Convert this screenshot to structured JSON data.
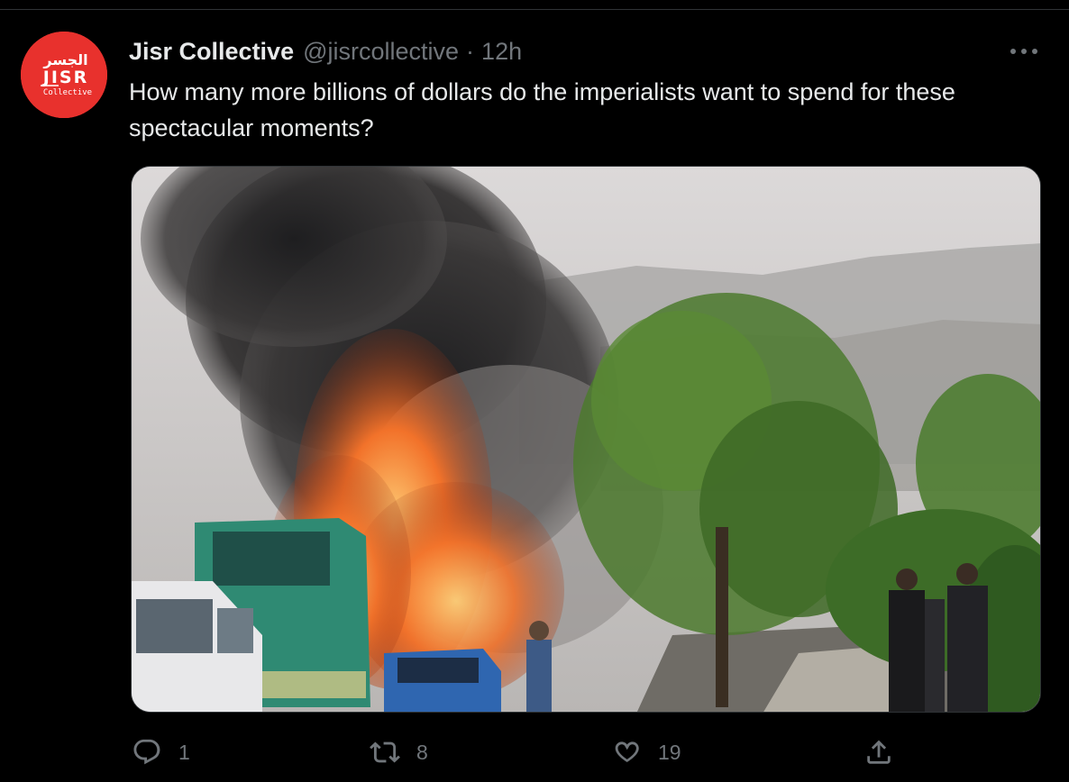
{
  "tweet": {
    "display_name": "Jisr Collective",
    "handle": "@jisrcollective",
    "separator": "·",
    "time": "12h",
    "text": "How many more billions of dollars do the imperialists want to spend for these spectacular moments?"
  },
  "avatar": {
    "arabic": "الجسر",
    "letters": "JISR",
    "subtitle": "Collective",
    "bg_color": "#e8312d"
  },
  "actions": {
    "reply_count": "1",
    "retweet_count": "8",
    "like_count": "19"
  },
  "icons": {
    "more": "more-horizontal-icon",
    "reply": "reply-icon",
    "retweet": "retweet-icon",
    "like": "heart-icon",
    "share": "share-icon"
  },
  "colors": {
    "background": "#000000",
    "text_primary": "#e7e9ea",
    "text_secondary": "#71767b"
  }
}
